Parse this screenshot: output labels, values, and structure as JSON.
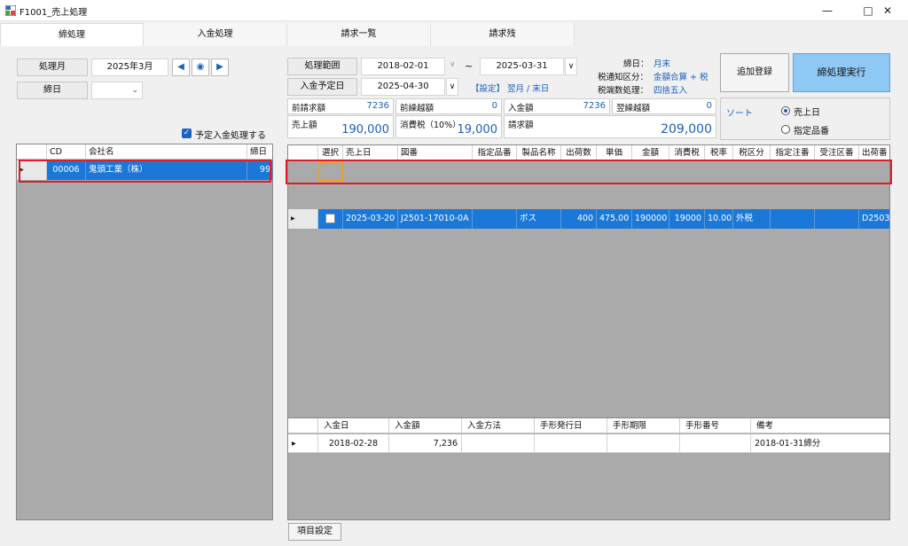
{
  "window": {
    "title": "F1001_売上処理"
  },
  "tabs": [
    "締処理",
    "入金処理",
    "請求一覧",
    "請求残"
  ],
  "left": {
    "month_label": "処理月",
    "month_value": "2025年3月",
    "closing_label": "締日",
    "closing_value": "",
    "planned_payment_label": "予定入金処理する",
    "grid": {
      "headers": [
        "CD",
        "会社名",
        "締日"
      ],
      "rows": [
        {
          "cd": "00006",
          "company": "鬼頭工業（株）",
          "closing": "99"
        }
      ]
    }
  },
  "header": {
    "range_label": "処理範囲",
    "range_from": "2018-02-01",
    "range_sep": "~",
    "range_to": "2025-03-31",
    "due_label": "入金予定日",
    "due_value": "2025-04-30",
    "setting_link": "【設定】 翌月 / 末日",
    "closing_day_label": "締日：",
    "closing_day_value": "月末",
    "tax_notice_label": "税通知区分：",
    "tax_notice_value": "金額合算 + 税",
    "tax_round_label": "税端数処理：",
    "tax_round_value": "四捨五入"
  },
  "buttons": {
    "add": "追加登録",
    "run": "締処理実行",
    "item_settings": "項目設定"
  },
  "summary": {
    "prev_bill_label": "前請求額",
    "prev_bill": "7236",
    "prev_carry_label": "前繰越額",
    "prev_carry": "0",
    "payment_label": "入金額",
    "payment": "7236",
    "next_carry_label": "翌繰越額",
    "next_carry": "0",
    "sales_label": "売上額",
    "sales": "190,000",
    "tax_label": "消費税（10%）",
    "tax": "19,000",
    "bill_label": "請求額",
    "bill": "209,000"
  },
  "sort": {
    "label": "ソート",
    "opt1": "売上日",
    "opt2": "指定品番"
  },
  "main_grid": {
    "headers": [
      "選択",
      "売上日",
      "図番",
      "指定品番",
      "製品名称",
      "出荷数",
      "単価",
      "金額",
      "消費税",
      "税率",
      "税区分",
      "指定注番",
      "受注区番",
      "出荷番"
    ],
    "rows": [
      {
        "date": "2025-03-20",
        "drawing": "J2501-17010-0A",
        "spec": "",
        "product": "ボス",
        "qty": "400",
        "price": "475.00",
        "amount": "190000",
        "tax": "19000",
        "rate": "10.00",
        "tax_type": "外税",
        "order": "",
        "recv": "",
        "ship": "D2503"
      }
    ]
  },
  "payment_grid": {
    "headers": [
      "入金日",
      "入金額",
      "入金方法",
      "手形発行日",
      "手形期限",
      "手形番号",
      "備考"
    ],
    "rows": [
      {
        "date": "2018-02-28",
        "amount": "7,236",
        "method": "",
        "issue": "",
        "due": "",
        "no": "",
        "note": "2018-01-31締分"
      }
    ]
  }
}
